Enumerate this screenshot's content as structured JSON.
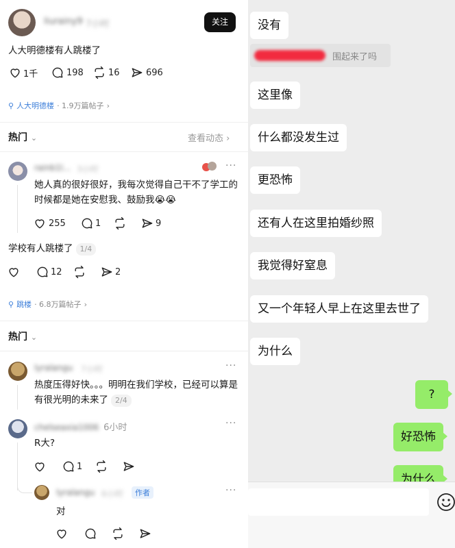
{
  "post": {
    "username": "liurainy9",
    "time": "7小时",
    "follow_label": "关注",
    "title": "人大明德楼有人跳楼了",
    "likes": "1千",
    "comments": "198",
    "reposts": "16",
    "shares": "696",
    "topic_name": "人大明德楼",
    "topic_count": "· 1.9万篇帖子",
    "hot_label": "热门",
    "view_activity": "查看动态"
  },
  "comment1": {
    "username": "rainb1l...",
    "time": "3小时",
    "text": "她人真的很好很好，我每次觉得自己干不了学工的时候都是她在安慰我、鼓励我😭😭",
    "likes": "255",
    "comments": "1",
    "shares": "9"
  },
  "post2": {
    "text": "学校有人跳楼了",
    "pager": "1/4",
    "comments": "12",
    "shares": "2",
    "topic_name": "跳楼",
    "topic_count": "· 6.8万篇帖子",
    "hot_label": "热门"
  },
  "comment2": {
    "username": "lyralangu",
    "time": "7小时",
    "text": "热度压得好快。。。明明在我们学校，已经可以算是有很光明的未来了",
    "pager": "2/4"
  },
  "comment3": {
    "username": "chelseaxia1006",
    "time": "6小时",
    "text": "R大?",
    "comments": "1"
  },
  "reply": {
    "username": "lyralangu",
    "time": "6小时",
    "author_badge": "作者",
    "text": "对"
  },
  "chat": {
    "messages": [
      {
        "text": "没有",
        "side": "left"
      },
      {
        "text": "围起来了吗",
        "side": "left"
      },
      {
        "text": "这里像",
        "side": "left"
      },
      {
        "text": "什么都没发生过",
        "side": "left"
      },
      {
        "text": "更恐怖",
        "side": "left"
      },
      {
        "text": "还有人在这里拍婚纱照",
        "side": "left"
      },
      {
        "text": "我觉得好窒息",
        "side": "left"
      },
      {
        "text": "又一个年轻人早上在这里去世了",
        "side": "left"
      },
      {
        "text": "为什么",
        "side": "left"
      },
      {
        "text": "?",
        "side": "right"
      },
      {
        "text": "好恐怖",
        "side": "right"
      },
      {
        "text": "为什么",
        "side": "right"
      }
    ],
    "input_value": "",
    "emoji_icon": "emoji-icon"
  },
  "colors": {
    "accent_blue": "#3d7fd9",
    "chat_bg": "#ededed",
    "my_bubble": "#95ec69",
    "badge_bg": "#e8f1fc"
  }
}
